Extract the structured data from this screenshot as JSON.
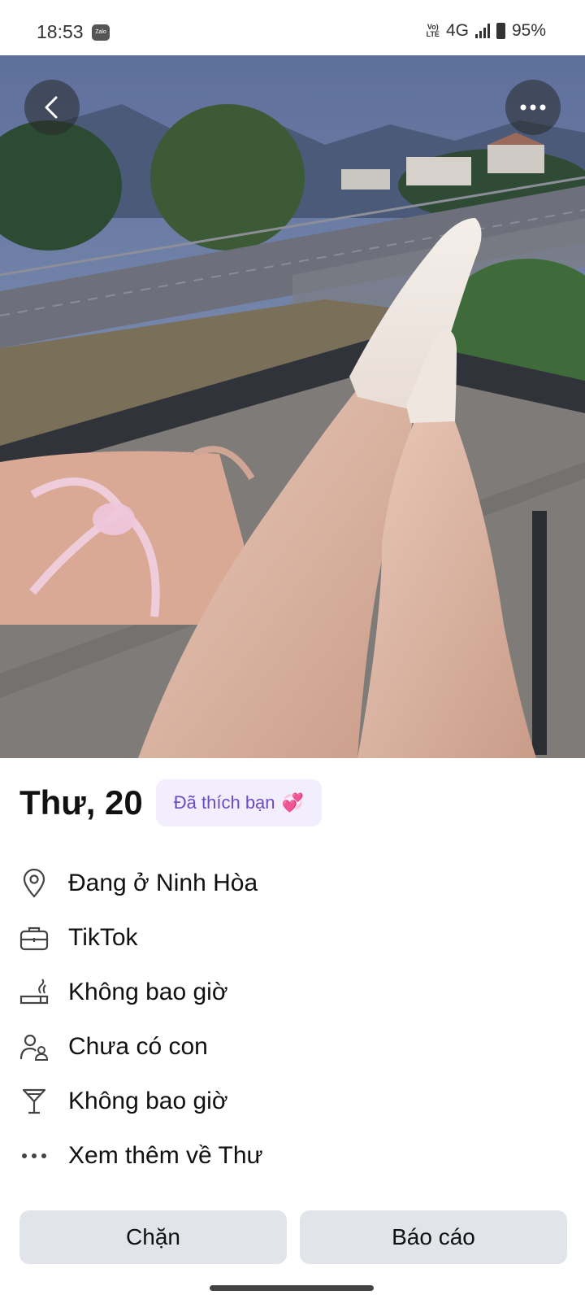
{
  "status_bar": {
    "time": "18:53",
    "zalo_label": "Zalo",
    "volte_top": "Vo)",
    "volte_bottom": "LTE",
    "network": "4G",
    "battery": "95%"
  },
  "photo": {
    "back_icon": "chevron-left-icon",
    "more_icon": "more-horizontal-icon"
  },
  "profile": {
    "name_age": "Thư, 20",
    "liked_badge": "Đã thích bạn",
    "liked_emoji": "💞"
  },
  "info": [
    {
      "icon": "location-pin-icon",
      "text": "Đang ở Ninh Hòa"
    },
    {
      "icon": "briefcase-icon",
      "text": "TikTok"
    },
    {
      "icon": "smoking-icon",
      "text": "Không bao giờ"
    },
    {
      "icon": "children-icon",
      "text": "Chưa có con"
    },
    {
      "icon": "cocktail-glass-icon",
      "text": "Không bao giờ"
    },
    {
      "icon": "more-dots-icon",
      "text": "Xem thêm về Thư"
    }
  ],
  "actions": {
    "block": "Chặn",
    "report": "Báo cáo"
  },
  "colors": {
    "badge_bg": "#f3eefd",
    "badge_text": "#6a4bc4",
    "button_bg": "#e1e5ea"
  }
}
